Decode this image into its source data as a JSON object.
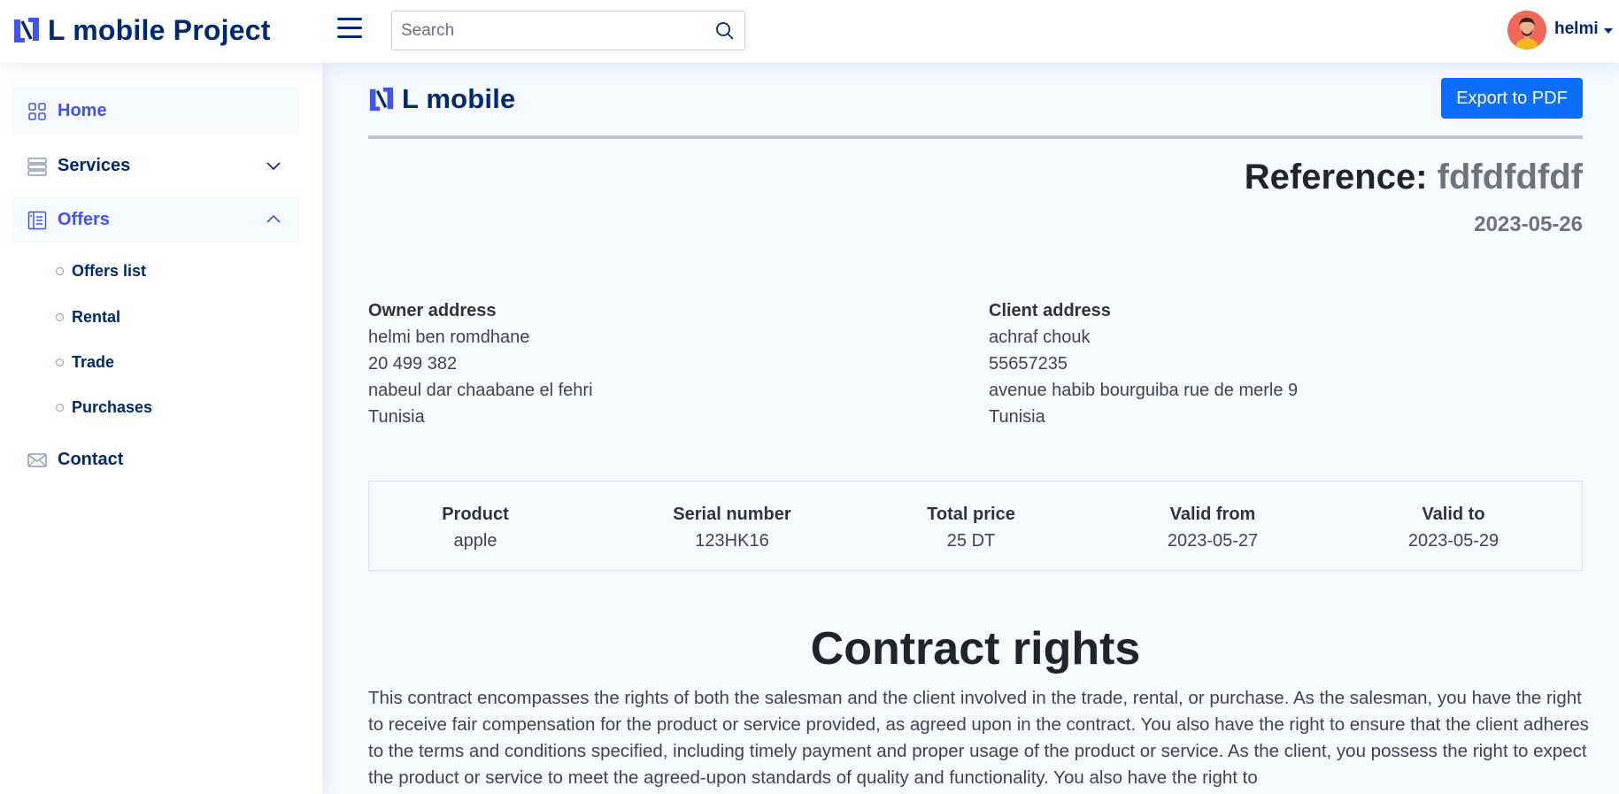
{
  "header": {
    "app_title": "L mobile Project",
    "search_placeholder": "Search",
    "user_name": "helmi"
  },
  "sidebar": {
    "items": [
      {
        "label": "Home"
      },
      {
        "label": "Services"
      },
      {
        "label": "Offers"
      },
      {
        "label": "Contact"
      }
    ],
    "offers_subitems": [
      {
        "label": "Offers list"
      },
      {
        "label": "Rental"
      },
      {
        "label": "Trade"
      },
      {
        "label": "Purchases"
      }
    ]
  },
  "document": {
    "logo_text": "L mobile",
    "export_label": "Export to PDF",
    "reference_label": "Reference:",
    "reference_value": "fdfdfdfdf",
    "date": "2023-05-26",
    "owner": {
      "heading": "Owner address",
      "name": "helmi ben romdhane",
      "phone": "20 499 382",
      "street": "nabeul dar chaabane el fehri",
      "country": "Tunisia"
    },
    "client": {
      "heading": "Client address",
      "name": "achraf chouk",
      "phone": "55657235",
      "street": "avenue habib bourguiba rue de merle 9",
      "country": "Tunisia"
    },
    "table": {
      "headers": [
        "Product",
        "Serial number",
        "Total price",
        "Valid from",
        "Valid to"
      ],
      "values": [
        "apple",
        "123HK16",
        "25 DT",
        "2023-05-27",
        "2023-05-29"
      ]
    },
    "rights_title": "Contract rights",
    "rights_text": "This contract encompasses the rights of both the salesman and the client involved in the trade, rental, or purchase. As the salesman, you have the right to receive fair compensation for the product or service provided, as agreed upon in the contract. You also have the right to ensure that the client adheres to the terms and conditions specified, including timely payment and proper usage of the product or service. As the client, you possess the right to expect the product or service to meet the agreed-upon standards of quality and functionality. You also have the right to"
  },
  "colors": {
    "brand": "#012970",
    "accent": "#4154f1",
    "primary_button": "#0d6efd",
    "page_bg": "#f6f9ff"
  }
}
